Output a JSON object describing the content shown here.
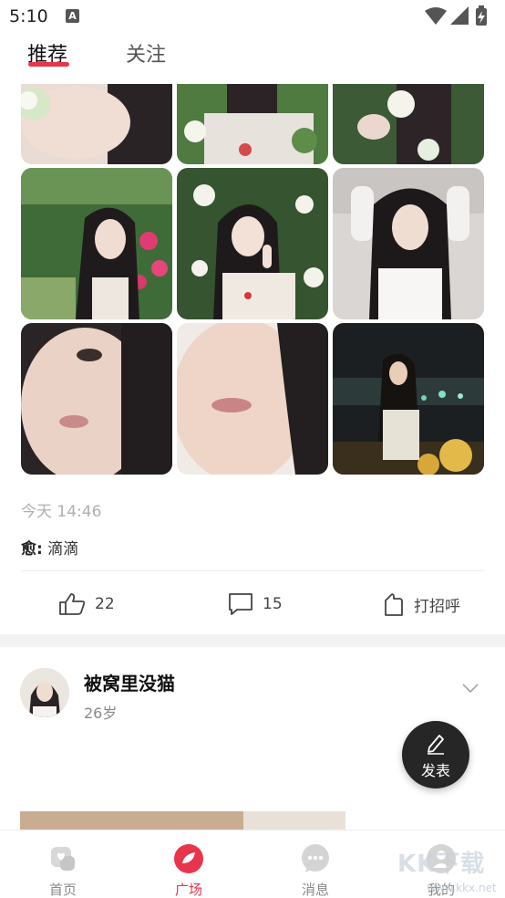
{
  "status_bar": {
    "time": "5:10",
    "notification_icon": "A",
    "icons": [
      "wifi-icon",
      "signal-icon",
      "battery-charging-icon"
    ]
  },
  "top_tabs": [
    {
      "label": "推荐",
      "active": true
    },
    {
      "label": "关注",
      "active": false
    }
  ],
  "accent_color": "#e8354c",
  "post1": {
    "photos": [
      "photo-flowers-1",
      "photo-flowers-2",
      "photo-flowers-3",
      "photo-garden-roses",
      "photo-peace-sign",
      "photo-hands-on-head",
      "photo-closeup-1",
      "photo-closeup-2",
      "photo-night-lights"
    ],
    "timestamp": "今天 14:46",
    "caption_author": "愈:",
    "caption_text": "滴滴",
    "likes": "22",
    "comments": "15",
    "greet_label": "打招呼"
  },
  "post2": {
    "username": "被窝里没猫",
    "age": "26岁"
  },
  "fab": {
    "label": "发表",
    "icon": "pencil-icon"
  },
  "bottom_nav": [
    {
      "label": "首页",
      "icon": "home-icon",
      "active": false
    },
    {
      "label": "广场",
      "icon": "plaza-icon",
      "active": true
    },
    {
      "label": "消息",
      "icon": "message-icon",
      "active": false
    },
    {
      "label": "我的",
      "icon": "profile-icon",
      "active": false
    }
  ],
  "watermark": {
    "main": "KK下载",
    "sub": "www.kkx.net"
  }
}
